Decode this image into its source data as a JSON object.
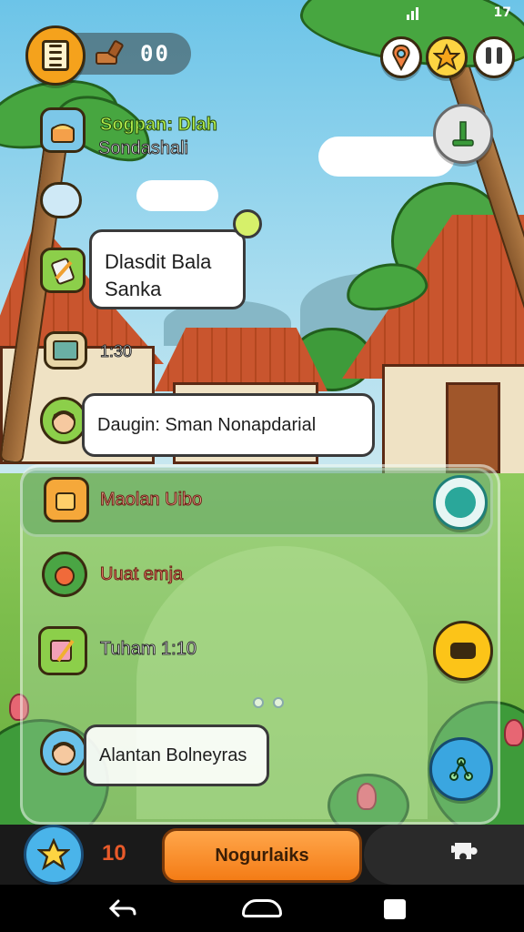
{
  "status_bar": {
    "signal": "",
    "battery": "17"
  },
  "hud": {
    "resource_count": "00"
  },
  "quests": {
    "q1": {
      "title": "Sogpan: Dlah",
      "subtitle": "Sondashali"
    },
    "q2": {
      "bubble_line1": "Dlasdit Bala",
      "bubble_line2": "Sanka"
    },
    "q3": {
      "label": "1:30"
    },
    "q4": {
      "bubble": "Daugin: Sman Nonapdarial"
    }
  },
  "list": {
    "row1": "Maolan Uibo",
    "row2": "Uuat emja",
    "row3": "Tuham 1:10",
    "row4": "Alantan Bolneyras"
  },
  "bottom": {
    "stars": "10",
    "cta_label": "Nogurlaiks"
  },
  "colors": {
    "cta": "#f47c16",
    "accent_green": "#b6f04c",
    "star": "#fdd442"
  }
}
